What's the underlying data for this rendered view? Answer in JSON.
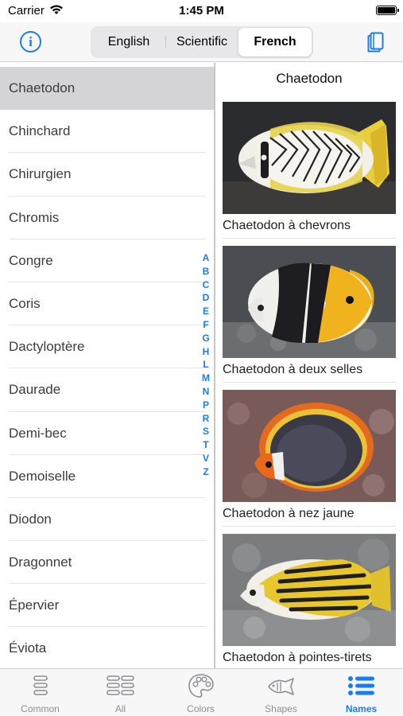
{
  "status": {
    "carrier": "Carrier",
    "time": "1:45 PM"
  },
  "navbar": {
    "info_icon": "info-circle-icon",
    "segments": [
      "English",
      "Scientific",
      "French"
    ],
    "selected_segment": "French",
    "book_icon": "book-icon"
  },
  "list": {
    "items": [
      "Chaetodon",
      "Chinchard",
      "Chirurgien",
      "Chromis",
      "Congre",
      "Coris",
      "Dactyloptère",
      "Daurade",
      "Demi-bec",
      "Demoiselle",
      "Diodon",
      "Dragonnet",
      "Épervier",
      "Éviota"
    ],
    "selected": "Chaetodon"
  },
  "index_letters": [
    "A",
    "B",
    "C",
    "D",
    "E",
    "F",
    "G",
    "H",
    "L",
    "M",
    "N",
    "P",
    "R",
    "S",
    "T",
    "V",
    "Z"
  ],
  "detail": {
    "title": "Chaetodon",
    "fish": [
      {
        "caption": "Chaetodon à chevrons"
      },
      {
        "caption": "Chaetodon à deux selles"
      },
      {
        "caption": "Chaetodon à nez jaune"
      },
      {
        "caption": "Chaetodon à pointes-tirets"
      }
    ]
  },
  "tabs": [
    {
      "label": "Common",
      "icon": "common-list-icon"
    },
    {
      "label": "All",
      "icon": "grid-list-icon"
    },
    {
      "label": "Colors",
      "icon": "palette-icon"
    },
    {
      "label": "Shapes",
      "icon": "fish-icon"
    },
    {
      "label": "Names",
      "icon": "list-bullets-icon"
    }
  ],
  "active_tab": "Names",
  "colors": {
    "accent": "#1a7cf5",
    "selected_row": "#d4d4d6",
    "inactive_tab": "#8e8e93"
  }
}
